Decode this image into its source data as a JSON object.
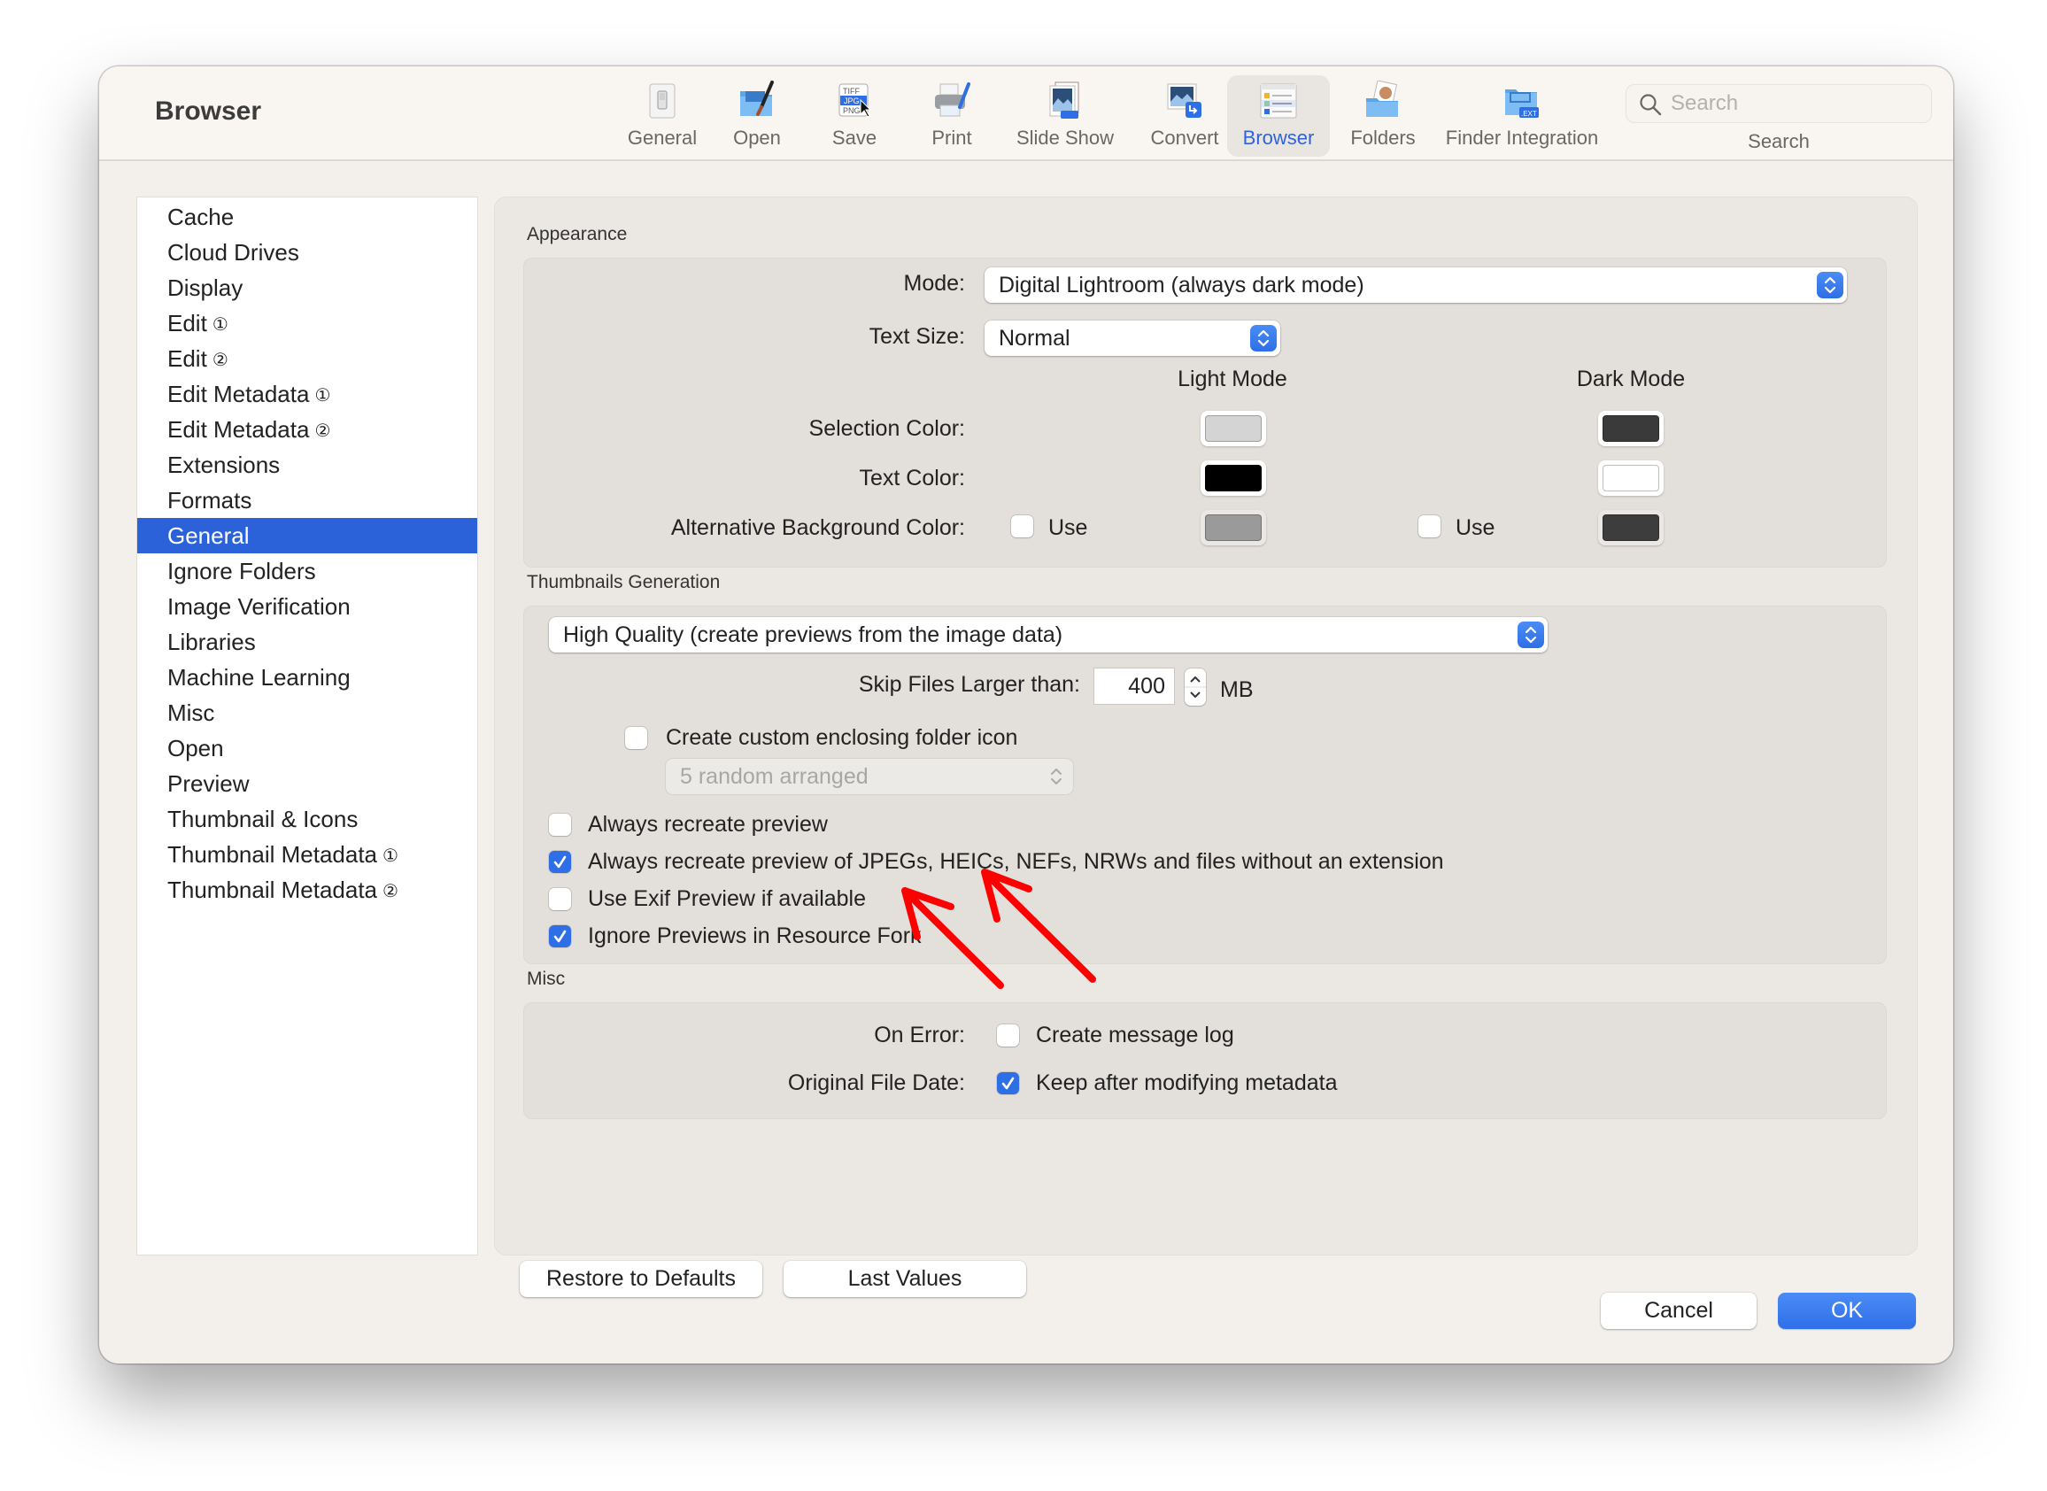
{
  "window": {
    "title": "Browser"
  },
  "toolbar": {
    "items": [
      {
        "label": "General",
        "icon": "switch-icon",
        "active": false
      },
      {
        "label": "Open",
        "icon": "folder-brush-icon",
        "active": false
      },
      {
        "label": "Save",
        "icon": "file-formats-icon",
        "active": false
      },
      {
        "label": "Print",
        "icon": "printer-icon",
        "active": false
      },
      {
        "label": "Slide Show",
        "icon": "slideshow-icon",
        "active": false
      },
      {
        "label": "Convert",
        "icon": "convert-icon",
        "active": false
      },
      {
        "label": "Browser",
        "icon": "browser-window-icon",
        "active": true
      },
      {
        "label": "Folders",
        "icon": "photo-folder-icon",
        "active": false
      },
      {
        "label": "Finder Integration",
        "icon": "folder-ext-icon",
        "active": false
      }
    ],
    "search": {
      "placeholder": "Search",
      "value": "",
      "label": "Search"
    }
  },
  "sidebar": {
    "selected": "General",
    "items": [
      {
        "label": "Cache",
        "badge": ""
      },
      {
        "label": "Cloud Drives",
        "badge": ""
      },
      {
        "label": "Display",
        "badge": ""
      },
      {
        "label": "Edit",
        "badge": "①"
      },
      {
        "label": "Edit",
        "badge": "②"
      },
      {
        "label": "Edit Metadata",
        "badge": "①"
      },
      {
        "label": "Edit Metadata",
        "badge": "②"
      },
      {
        "label": "Extensions",
        "badge": ""
      },
      {
        "label": "Formats",
        "badge": ""
      },
      {
        "label": "General",
        "badge": ""
      },
      {
        "label": "Ignore Folders",
        "badge": ""
      },
      {
        "label": "Image Verification",
        "badge": ""
      },
      {
        "label": "Libraries",
        "badge": ""
      },
      {
        "label": "Machine Learning",
        "badge": ""
      },
      {
        "label": "Misc",
        "badge": ""
      },
      {
        "label": "Open",
        "badge": ""
      },
      {
        "label": "Preview",
        "badge": ""
      },
      {
        "label": "Thumbnail & Icons",
        "badge": ""
      },
      {
        "label": "Thumbnail Metadata",
        "badge": "①"
      },
      {
        "label": "Thumbnail Metadata",
        "badge": "②"
      }
    ]
  },
  "appearance": {
    "title": "Appearance",
    "mode_label": "Mode:",
    "mode_value": "Digital Lightroom (always dark mode)",
    "text_size_label": "Text Size:",
    "text_size_value": "Normal",
    "light_mode_header": "Light Mode",
    "dark_mode_header": "Dark Mode",
    "selection_color_label": "Selection Color:",
    "text_color_label": "Text Color:",
    "alt_bg_label": "Alternative Background Color:",
    "use_label": "Use",
    "colors": {
      "selection_light": "#d4d4d4",
      "selection_dark": "#3a3a3a",
      "text_light": "#000000",
      "text_dark": "#ffffff",
      "alt_bg_light": "#9a9a9a",
      "alt_bg_dark": "#3d3d3d"
    },
    "alt_bg_light_use": false,
    "alt_bg_dark_use": false
  },
  "thumbnails": {
    "title": "Thumbnails Generation",
    "quality_value": "High Quality (create previews from the image data)",
    "skip_label": "Skip Files Larger than:",
    "skip_value": "400",
    "skip_unit": "MB",
    "custom_folder_icon": {
      "label": "Create custom enclosing folder icon",
      "checked": false
    },
    "folder_icon_style": "5 random arranged",
    "options": [
      {
        "label": "Always recreate preview",
        "checked": false
      },
      {
        "label": "Always recreate preview of JPEGs, HEICs, NEFs, NRWs and files without an extension",
        "checked": true
      },
      {
        "label": "Use Exif Preview if available",
        "checked": false
      },
      {
        "label": "Ignore Previews in Resource Fork",
        "checked": true
      }
    ]
  },
  "misc": {
    "title": "Misc",
    "on_error_label": "On Error:",
    "on_error_option": {
      "label": "Create message log",
      "checked": false
    },
    "file_date_label": "Original File Date:",
    "file_date_option": {
      "label": "Keep after modifying metadata",
      "checked": true
    }
  },
  "buttons": {
    "restore": "Restore to Defaults",
    "last_values": "Last Values",
    "cancel": "Cancel",
    "ok": "OK"
  },
  "annotation": {
    "arrow_color": "#ff0000"
  },
  "accent_color": "#2f6fe6"
}
